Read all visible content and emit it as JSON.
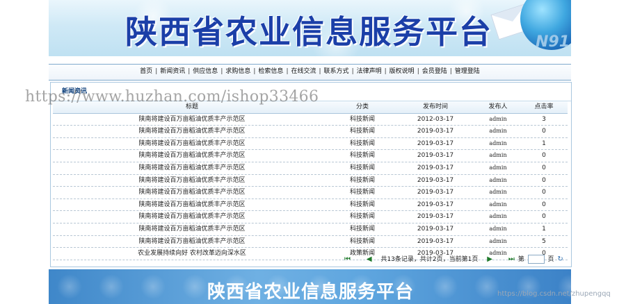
{
  "banner": {
    "title": "陕西省农业信息服务平台",
    "number": "N91"
  },
  "nav": {
    "items": [
      "首页",
      "新闻资讯",
      "供应信息",
      "求购信息",
      "检索信息",
      "在线交流",
      "联系方式",
      "法律声明",
      "版权说明",
      "会员登陆",
      "管理登陆"
    ],
    "separator": "|"
  },
  "news": {
    "section_title": "新闻资讯",
    "columns": [
      "标题",
      "分类",
      "发布时间",
      "发布人",
      "点击率"
    ],
    "rows": [
      [
        "陕南将建设百万亩稻油优质丰产示范区",
        "科技新闻",
        "2012-03-17",
        "admin",
        "3"
      ],
      [
        "陕南将建设百万亩稻油优质丰产示范区",
        "科技新闻",
        "2019-03-17",
        "admin",
        "0"
      ],
      [
        "陕南将建设百万亩稻油优质丰产示范区",
        "科技新闻",
        "2019-03-17",
        "admin",
        "1"
      ],
      [
        "陕南将建设百万亩稻油优质丰产示范区",
        "科技新闻",
        "2019-03-17",
        "admin",
        "0"
      ],
      [
        "陕南将建设百万亩稻油优质丰产示范区",
        "科技新闻",
        "2019-03-17",
        "admin",
        "0"
      ],
      [
        "陕南将建设百万亩稻油优质丰产示范区",
        "科技新闻",
        "2019-03-17",
        "admin",
        "0"
      ],
      [
        "陕南将建设百万亩稻油优质丰产示范区",
        "科技新闻",
        "2019-03-17",
        "admin",
        "0"
      ],
      [
        "陕南将建设百万亩稻油优质丰产示范区",
        "科技新闻",
        "2019-03-17",
        "admin",
        "0"
      ],
      [
        "陕南将建设百万亩稻油优质丰产示范区",
        "科技新闻",
        "2019-03-17",
        "admin",
        "0"
      ],
      [
        "陕南将建设百万亩稻油优质丰产示范区",
        "科技新闻",
        "2019-03-17",
        "admin",
        "1"
      ],
      [
        "陕南将建设百万亩稻油优质丰产示范区",
        "科技新闻",
        "2019-03-17",
        "admin",
        "5"
      ],
      [
        "农业发展持续向好 农村改革迈向深水区",
        "政策新闻",
        "2019-03-17",
        "admin",
        "0"
      ]
    ]
  },
  "pager": {
    "first_icon": "first-page-icon",
    "prev_icon": "prev-page-icon",
    "next_icon": "next-page-icon",
    "last_icon": "last-page-icon",
    "summary": "共13条记录，共计2页，当前第1页",
    "page_prefix": "第",
    "page_suffix": "页",
    "first": "⏮",
    "prev": "◀",
    "next": "▶",
    "last": "⏭",
    "go": "↻"
  },
  "footer": {
    "title": "陕西省农业信息服务平台"
  },
  "watermarks": {
    "main": "https://www.huzhan.com/ishop33466",
    "corner": "https://blog.csdn.net/zhupengqq"
  },
  "colors": {
    "nav_border": "#7fa9cc",
    "title_blue": "#1b3fa8",
    "pager_green": "#1f7a2a"
  }
}
